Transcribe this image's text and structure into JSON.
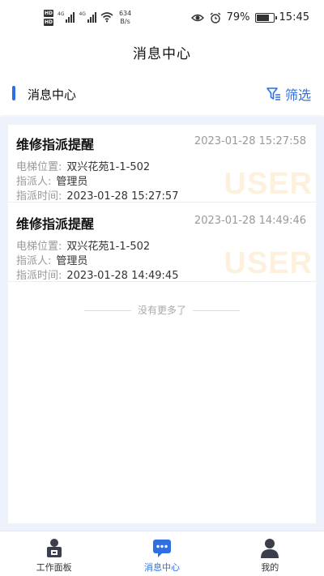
{
  "status_bar": {
    "hd1": "HD",
    "hd2": "HD",
    "signal1_label": "4G",
    "signal2_label": "4G",
    "net_speed_value": "634",
    "net_speed_unit": "B/s",
    "battery": "79%",
    "time": "15:45"
  },
  "page_title": "消息中心",
  "section": {
    "title": "消息中心",
    "filter_label": "筛选"
  },
  "messages": [
    {
      "title": "维修指派提醒",
      "time": "2023-01-28 15:27:58",
      "location_key": "电梯位置:",
      "location": "双兴花苑1-1-502",
      "assignee_key": "指派人:",
      "assignee": "管理员",
      "assign_time_key": "指派时间:",
      "assign_time": "2023-01-28 15:27:57",
      "watermark": "USER"
    },
    {
      "title": "维修指派提醒",
      "time": "2023-01-28 14:49:46",
      "location_key": "电梯位置:",
      "location": "双兴花苑1-1-502",
      "assignee_key": "指派人:",
      "assignee": "管理员",
      "assign_time_key": "指派时间:",
      "assign_time": "2023-01-28 14:49:45",
      "watermark": "USER"
    }
  ],
  "no_more_text": "没有更多了",
  "bottom_nav": [
    {
      "label": "工作面板",
      "icon": "workbench-icon"
    },
    {
      "label": "消息中心",
      "icon": "message-icon",
      "active": true
    },
    {
      "label": "我的",
      "icon": "user-icon"
    }
  ],
  "colors": {
    "accent": "#2f6fe0",
    "background": "#eef3fb",
    "watermark": "#fdf1de"
  }
}
